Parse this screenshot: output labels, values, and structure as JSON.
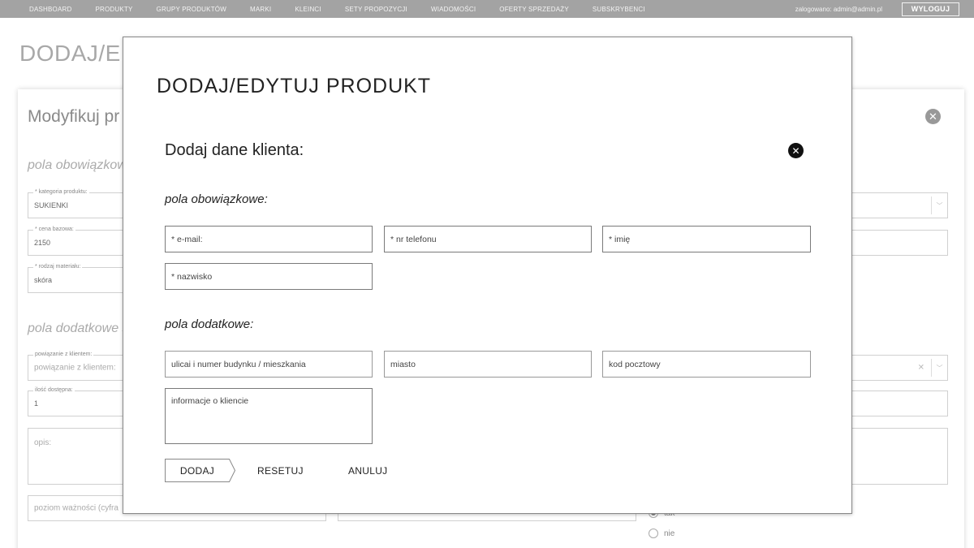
{
  "nav": {
    "items": [
      "DASHBOARD",
      "PRODUKTY",
      "GRUPY PRODUKTÓW",
      "MARKI",
      "KLEINCI",
      "SETY PROPOZYCJI",
      "WIADOMOŚCI",
      "OFERTY SPRZEDAŻY",
      "SUBSKRYBENCI"
    ],
    "logged_in": "zalogowano: admin@admin.pl",
    "logout_label": "WYLOGUJ"
  },
  "background": {
    "page_title": "DODAJ/EDY",
    "card_title": "Modyfikuj pr",
    "section_required": "pola obowiązkow",
    "section_optional": "pola dodatkowe s",
    "category_label": "* kategoria produktu:",
    "category_value": "SUKIENKI",
    "price_label": "* cena bazowa:",
    "price_value": "2150",
    "material_label": "* rodzaj materiału:",
    "material_value": "skóra",
    "client_link_label": "powiązanie z klientem:",
    "client_link_placeholder": "powiązanie z klientem:",
    "stock_label": "ilość dostępna:",
    "stock_value": "1",
    "description_placeholder": "opis:",
    "priority_placeholder": "poziom ważności (cyfra",
    "radio_yes": "tak",
    "radio_no": "nie"
  },
  "modal": {
    "title": "DODAJ/EDYTUJ PRODUKT",
    "subtitle": "Dodaj dane klienta:",
    "close_symbol": "✕",
    "section_required": "pola obowiązkowe:",
    "section_optional": "pola dodatkowe:",
    "fields": {
      "email": "* e-mail:",
      "phone": "* nr telefonu",
      "first_name": "* imię",
      "last_name": "* nazwisko",
      "street": "ulicai i numer budynku / mieszkania",
      "city": "miasto",
      "postal": "kod pocztowy",
      "info": "informacje o kliencie"
    },
    "buttons": {
      "add": "DODAJ",
      "reset": "RESETUJ",
      "cancel": "ANULUJ"
    }
  }
}
